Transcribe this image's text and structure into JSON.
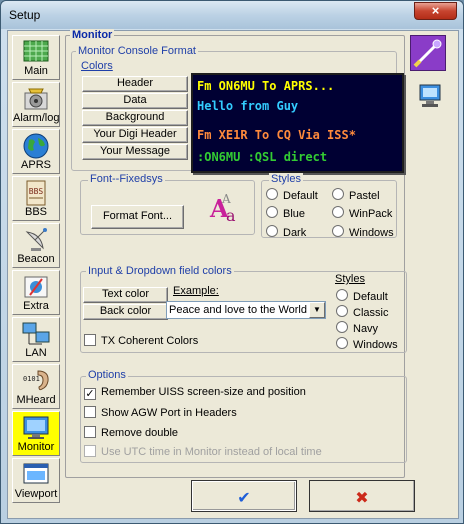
{
  "window": {
    "title": "Setup",
    "close_label": "×"
  },
  "sidebar": {
    "items": [
      {
        "label": "Main",
        "icon": "main-grid-icon"
      },
      {
        "label": "Alarm/log",
        "icon": "alarm-speaker-icon"
      },
      {
        "label": "APRS",
        "icon": "globe-icon"
      },
      {
        "label": "BBS",
        "icon": "bbs-icon"
      },
      {
        "label": "Beacon",
        "icon": "satellite-dish-icon"
      },
      {
        "label": "Extra",
        "icon": "extra-tools-icon"
      },
      {
        "label": "LAN",
        "icon": "lan-computers-icon"
      },
      {
        "label": "MHeard",
        "icon": "ear-icon"
      },
      {
        "label": "Monitor",
        "icon": "monitor-icon",
        "active": true
      },
      {
        "label": "Viewport",
        "icon": "viewport-icon"
      }
    ]
  },
  "main": {
    "title": "Monitor",
    "console_format": {
      "title": "Monitor Console Format",
      "colors_label": "Colors",
      "buttons": [
        "Header",
        "Data",
        "Background",
        "Your Digi Header",
        "Your Message"
      ],
      "preview": [
        {
          "text": "Fm ON6MU To APRS...",
          "color": "#ffff00"
        },
        {
          "text": "Hello from Guy",
          "color": "#33ccff"
        },
        {
          "text": "Fm XE1R To CQ Via ISS*",
          "color": "#ff8a3c"
        },
        {
          "text": ":ON6MU  :QSL direct",
          "color": "#33cc33"
        }
      ]
    },
    "font": {
      "title": "Font--Fixedsys",
      "button": "Format Font...",
      "icon": "font-aa-icon"
    },
    "styles": {
      "title": "Styles",
      "options": [
        "Default",
        "Pastel",
        "Blue",
        "WinPack",
        "Dark",
        "Windows"
      ]
    },
    "input_colors": {
      "title": "Input & Dropdown field colors",
      "text_color_btn": "Text color",
      "back_color_btn": "Back color",
      "example_label": "Example:",
      "example_value": "Peace and love to the World",
      "tx_coherent": "TX Coherent Colors",
      "styles_label": "Styles",
      "styles_options": [
        "Default",
        "Classic",
        "Navy",
        "Windows"
      ]
    },
    "options": {
      "title": "Options",
      "items": [
        {
          "label": "Remember UISS screen-size and position",
          "checked": true
        },
        {
          "label": "Show AGW Port in Headers",
          "checked": false
        },
        {
          "label": "Remove double",
          "checked": false
        },
        {
          "label": "Use UTC time in Monitor instead of local time",
          "checked": false,
          "disabled": true
        }
      ]
    }
  },
  "footer": {
    "ok_symbol": "✔",
    "cancel_symbol": "✖"
  }
}
